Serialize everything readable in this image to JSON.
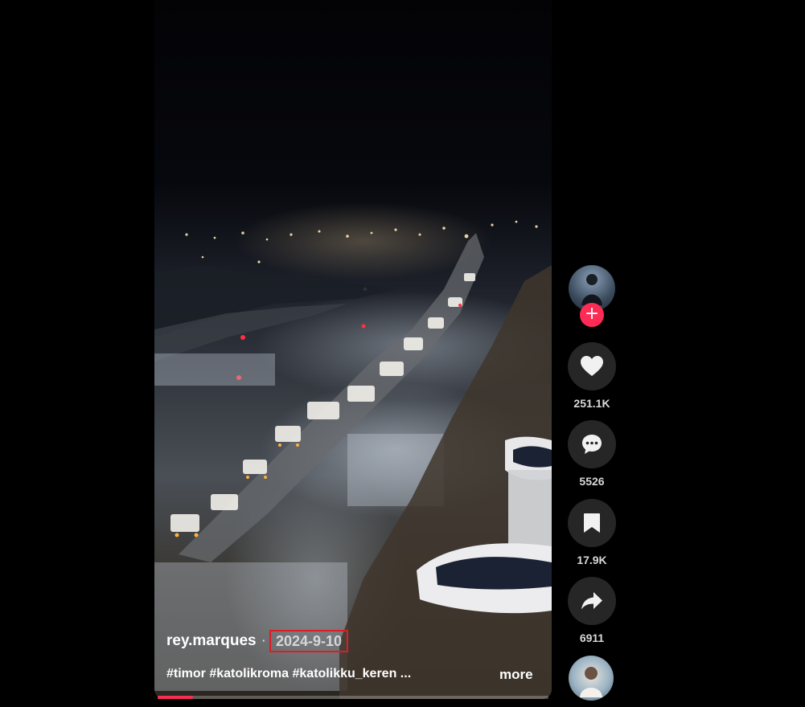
{
  "post": {
    "author": "rey.marques",
    "separator": "·",
    "date": "2024-9-10",
    "hashtags": "#timor #katolikroma #katolikku_keren ...",
    "more_label": "more",
    "progress": 0.09
  },
  "actions": {
    "likes": "251.1K",
    "comments": "5526",
    "saves": "17.9K",
    "shares": "6911"
  },
  "follow_symbol": "+",
  "colors": {
    "accent": "#fe2c55",
    "highlight_box": "#e01b24",
    "action_bg": "#262626"
  }
}
